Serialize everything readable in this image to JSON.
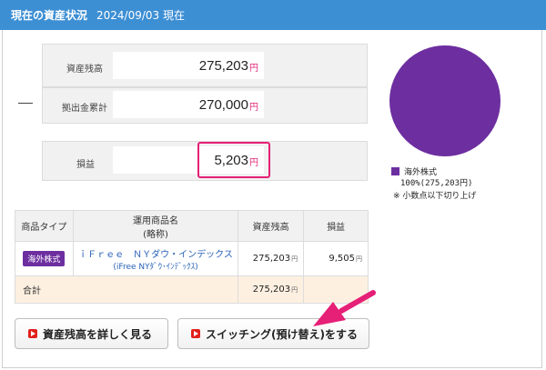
{
  "header": {
    "title": "現在の資産状況",
    "date": "2024/09/03 現在"
  },
  "summary": {
    "balance": {
      "label": "資産残高",
      "value": "275,203",
      "unit": "円"
    },
    "contribution": {
      "label": "拠出金累計",
      "value": "270,000",
      "unit": "円"
    },
    "minus_sign": "—",
    "profit": {
      "label": "損益",
      "value": "5,203",
      "unit": "円"
    }
  },
  "pie": {
    "share_percent": 100,
    "color": "#6d2ea0"
  },
  "legend": {
    "name": "海外株式",
    "value": "100%(275,203円)",
    "note": "※ 小数点以下切り上げ"
  },
  "table": {
    "headers": {
      "type": "商品タイプ",
      "product": "運用商品名",
      "product_sub": "(略称)",
      "balance": "資産残高",
      "profit": "損益"
    },
    "rows": [
      {
        "type": "海外株式",
        "name": "ｉＦｒｅｅ　ＮＹダウ・インデックス",
        "short": "(iFree NYﾀﾞｳ･ｲﾝﾃﾞｯｸｽ)",
        "balance": "275,203",
        "profit": "9,505",
        "unit": "円"
      }
    ],
    "total": {
      "label": "合計",
      "balance": "275,203",
      "unit": "円"
    }
  },
  "buttons": {
    "details": "資産残高を詳しく見る",
    "switching": "スイッチング(預け替え)をする"
  },
  "colors": {
    "header": "#3d8fd4",
    "accent": "#e61f77",
    "fund": "#6d2ea0"
  }
}
